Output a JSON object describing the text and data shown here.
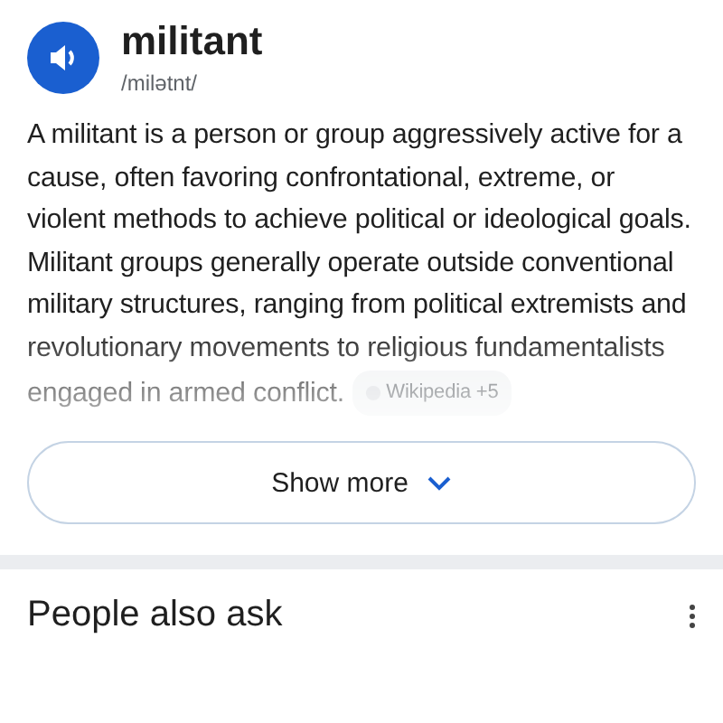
{
  "entry": {
    "word": "militant",
    "pronunciation": "/milətnt/"
  },
  "definition": {
    "text": "A militant is a person or group aggressively active for a cause, often favoring confrontational, extreme, or violent methods to achieve political or ideological goals. Militant groups generally operate outside conventional military structures, ranging from political extremists and revolutionary movements to religious fundamentalists engaged in armed conflict.",
    "source": "Wikipedia +5"
  },
  "show_more": {
    "label": "Show more"
  },
  "people_also_ask": {
    "title": "People also ask"
  }
}
